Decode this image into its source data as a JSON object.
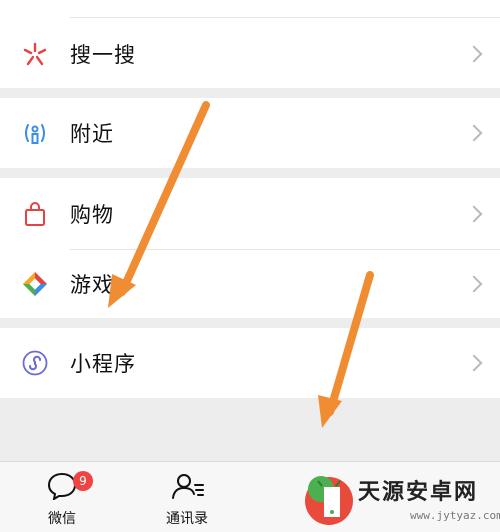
{
  "menu": {
    "search": {
      "label": "搜一搜",
      "icon": "search-sparkle-icon"
    },
    "nearby": {
      "label": "附近",
      "icon": "nearby-person-icon"
    },
    "shopping": {
      "label": "购物",
      "icon": "shopping-bag-icon"
    },
    "games": {
      "label": "游戏",
      "icon": "games-diamond-icon"
    },
    "mini_programs": {
      "label": "小程序",
      "icon": "mini-program-icon"
    }
  },
  "tabbar": {
    "chats": {
      "label": "微信",
      "badge": "9",
      "icon": "chat-bubble-icon"
    },
    "contacts": {
      "label": "通讯录",
      "icon": "contacts-icon"
    }
  },
  "watermark": {
    "title": "天源安卓网",
    "url": "www.jytyaz.com"
  },
  "colors": {
    "accent_arrow": "#f08c32",
    "badge": "#f04444",
    "search_icon": "#e64340",
    "nearby_icon": "#3a8ee6",
    "shopping_icon": "#e64340",
    "mini_program_icon": "#6b6bd6"
  }
}
